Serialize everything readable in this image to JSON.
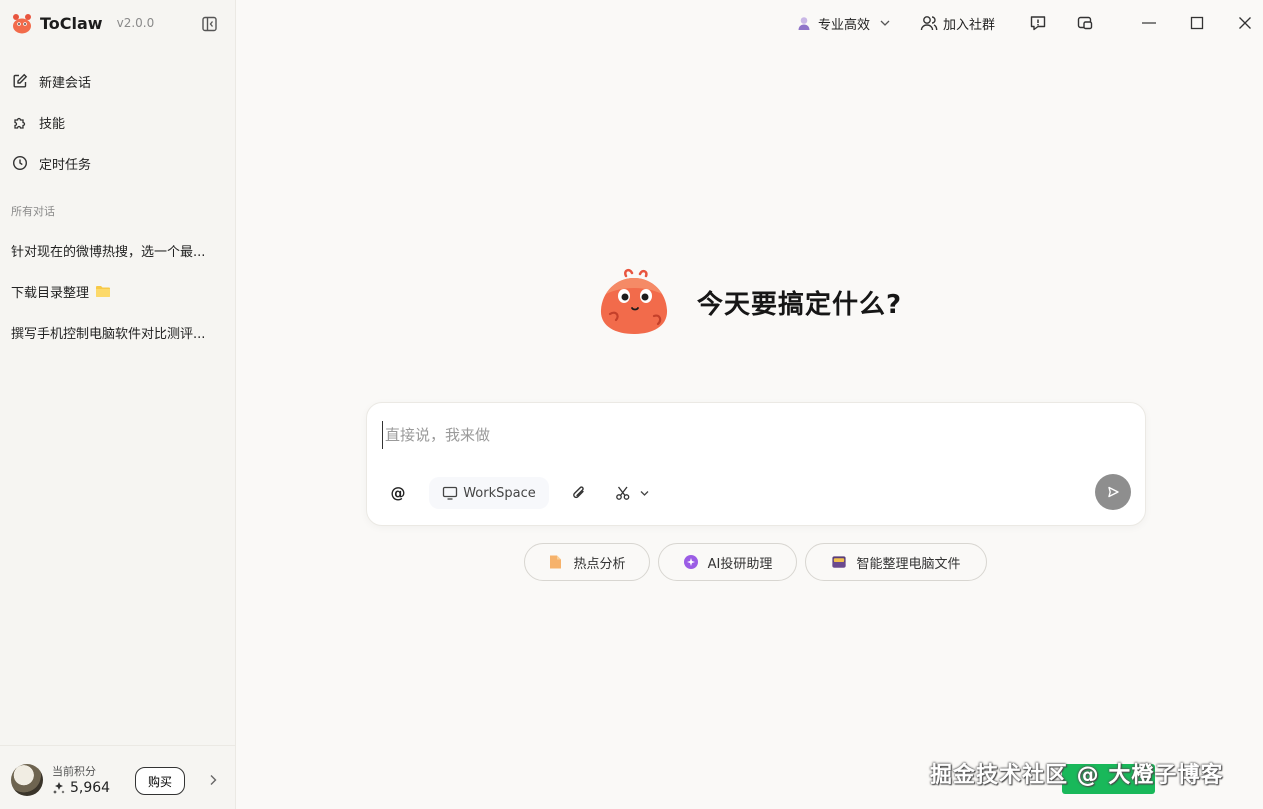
{
  "app": {
    "name": "ToClaw",
    "version": "v2.0.0"
  },
  "sidebar": {
    "nav": [
      {
        "label": "新建会话",
        "icon": "edit-icon"
      },
      {
        "label": "技能",
        "icon": "puzzle-icon"
      },
      {
        "label": "定时任务",
        "icon": "clock-icon"
      }
    ],
    "section_title": "所有对话",
    "conversations": [
      {
        "title": "针对现在的微博热搜，选一个最..."
      },
      {
        "title": "下载目录整理",
        "icon": "folder-icon"
      },
      {
        "title": "撰写手机控制电脑软件对比测评..."
      }
    ],
    "footer": {
      "points_label": "当前积分",
      "points_value": "5,964",
      "buy_label": "购买"
    }
  },
  "topbar": {
    "mode_label": "专业高效",
    "community_label": "加入社群"
  },
  "main": {
    "hero_title": "今天要搞定什么?",
    "input_placeholder": "直接说，我来做",
    "at_label": "@",
    "workspace_label": "WorkSpace",
    "chips": [
      {
        "label": "热点分析",
        "icon": "document-icon",
        "color": "#f2a55c"
      },
      {
        "label": "AI投研助理",
        "icon": "sparkle-icon",
        "color": "#9b5de5"
      },
      {
        "label": "智能整理电脑文件",
        "icon": "folder-icon",
        "color": "#5a3d7a"
      }
    ]
  },
  "watermark": {
    "text": "掘金技术社区 @ 大橙子博客"
  },
  "colors": {
    "accent": "#f26b4b",
    "send_button": "#8e8e8e",
    "watermark_badge": "#19b85a"
  }
}
